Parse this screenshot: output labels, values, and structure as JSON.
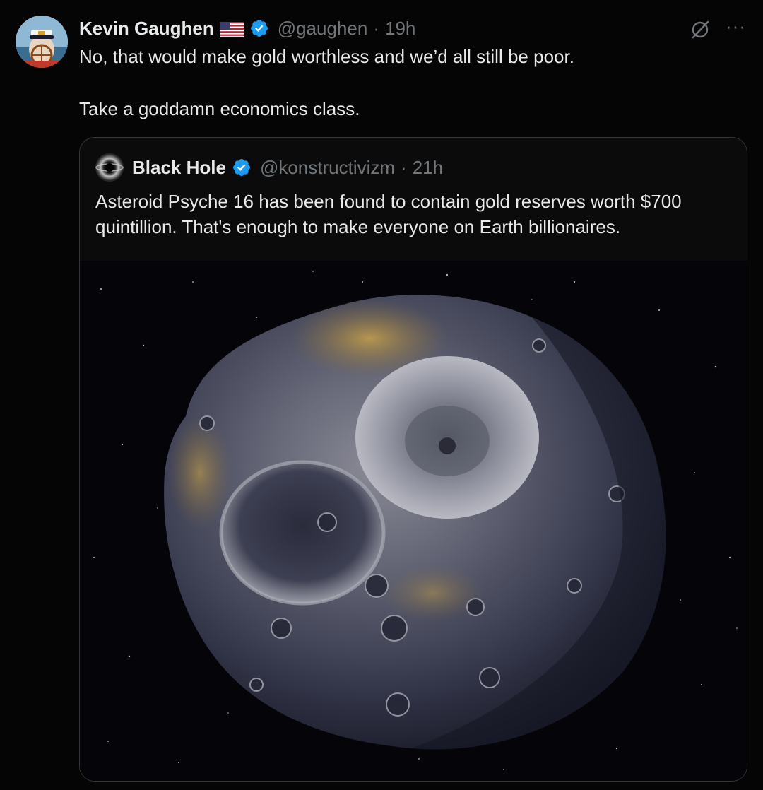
{
  "tweet": {
    "author_name": "Kevin Gaughen",
    "author_handle": "@gaughen",
    "separator": "·",
    "time": "19h",
    "flag_icon": "us-flag-icon",
    "verified_icon": "verified-badge-icon",
    "paragraphs": [
      "No, that would make gold worthless and we’d all still be poor.",
      "Take a goddamn economics class."
    ]
  },
  "actions": {
    "grok_icon": "grok-icon",
    "more_icon": "more-options-icon",
    "more_label": "···"
  },
  "quote": {
    "author_name": "Black Hole",
    "author_handle": "@konstructivizm",
    "separator": "·",
    "time": "21h",
    "text": "Asteroid Psyche 16 has been found to contain gold reserves worth $700 quintillion. That's enough to make everyone on Earth billionaires.",
    "media_icon": "asteroid-image"
  },
  "colors": {
    "background": "#000000",
    "text_primary": "#e7e9ea",
    "text_secondary": "#71767b",
    "verified_blue": "#1d9bf0",
    "quote_border": "#333639"
  }
}
